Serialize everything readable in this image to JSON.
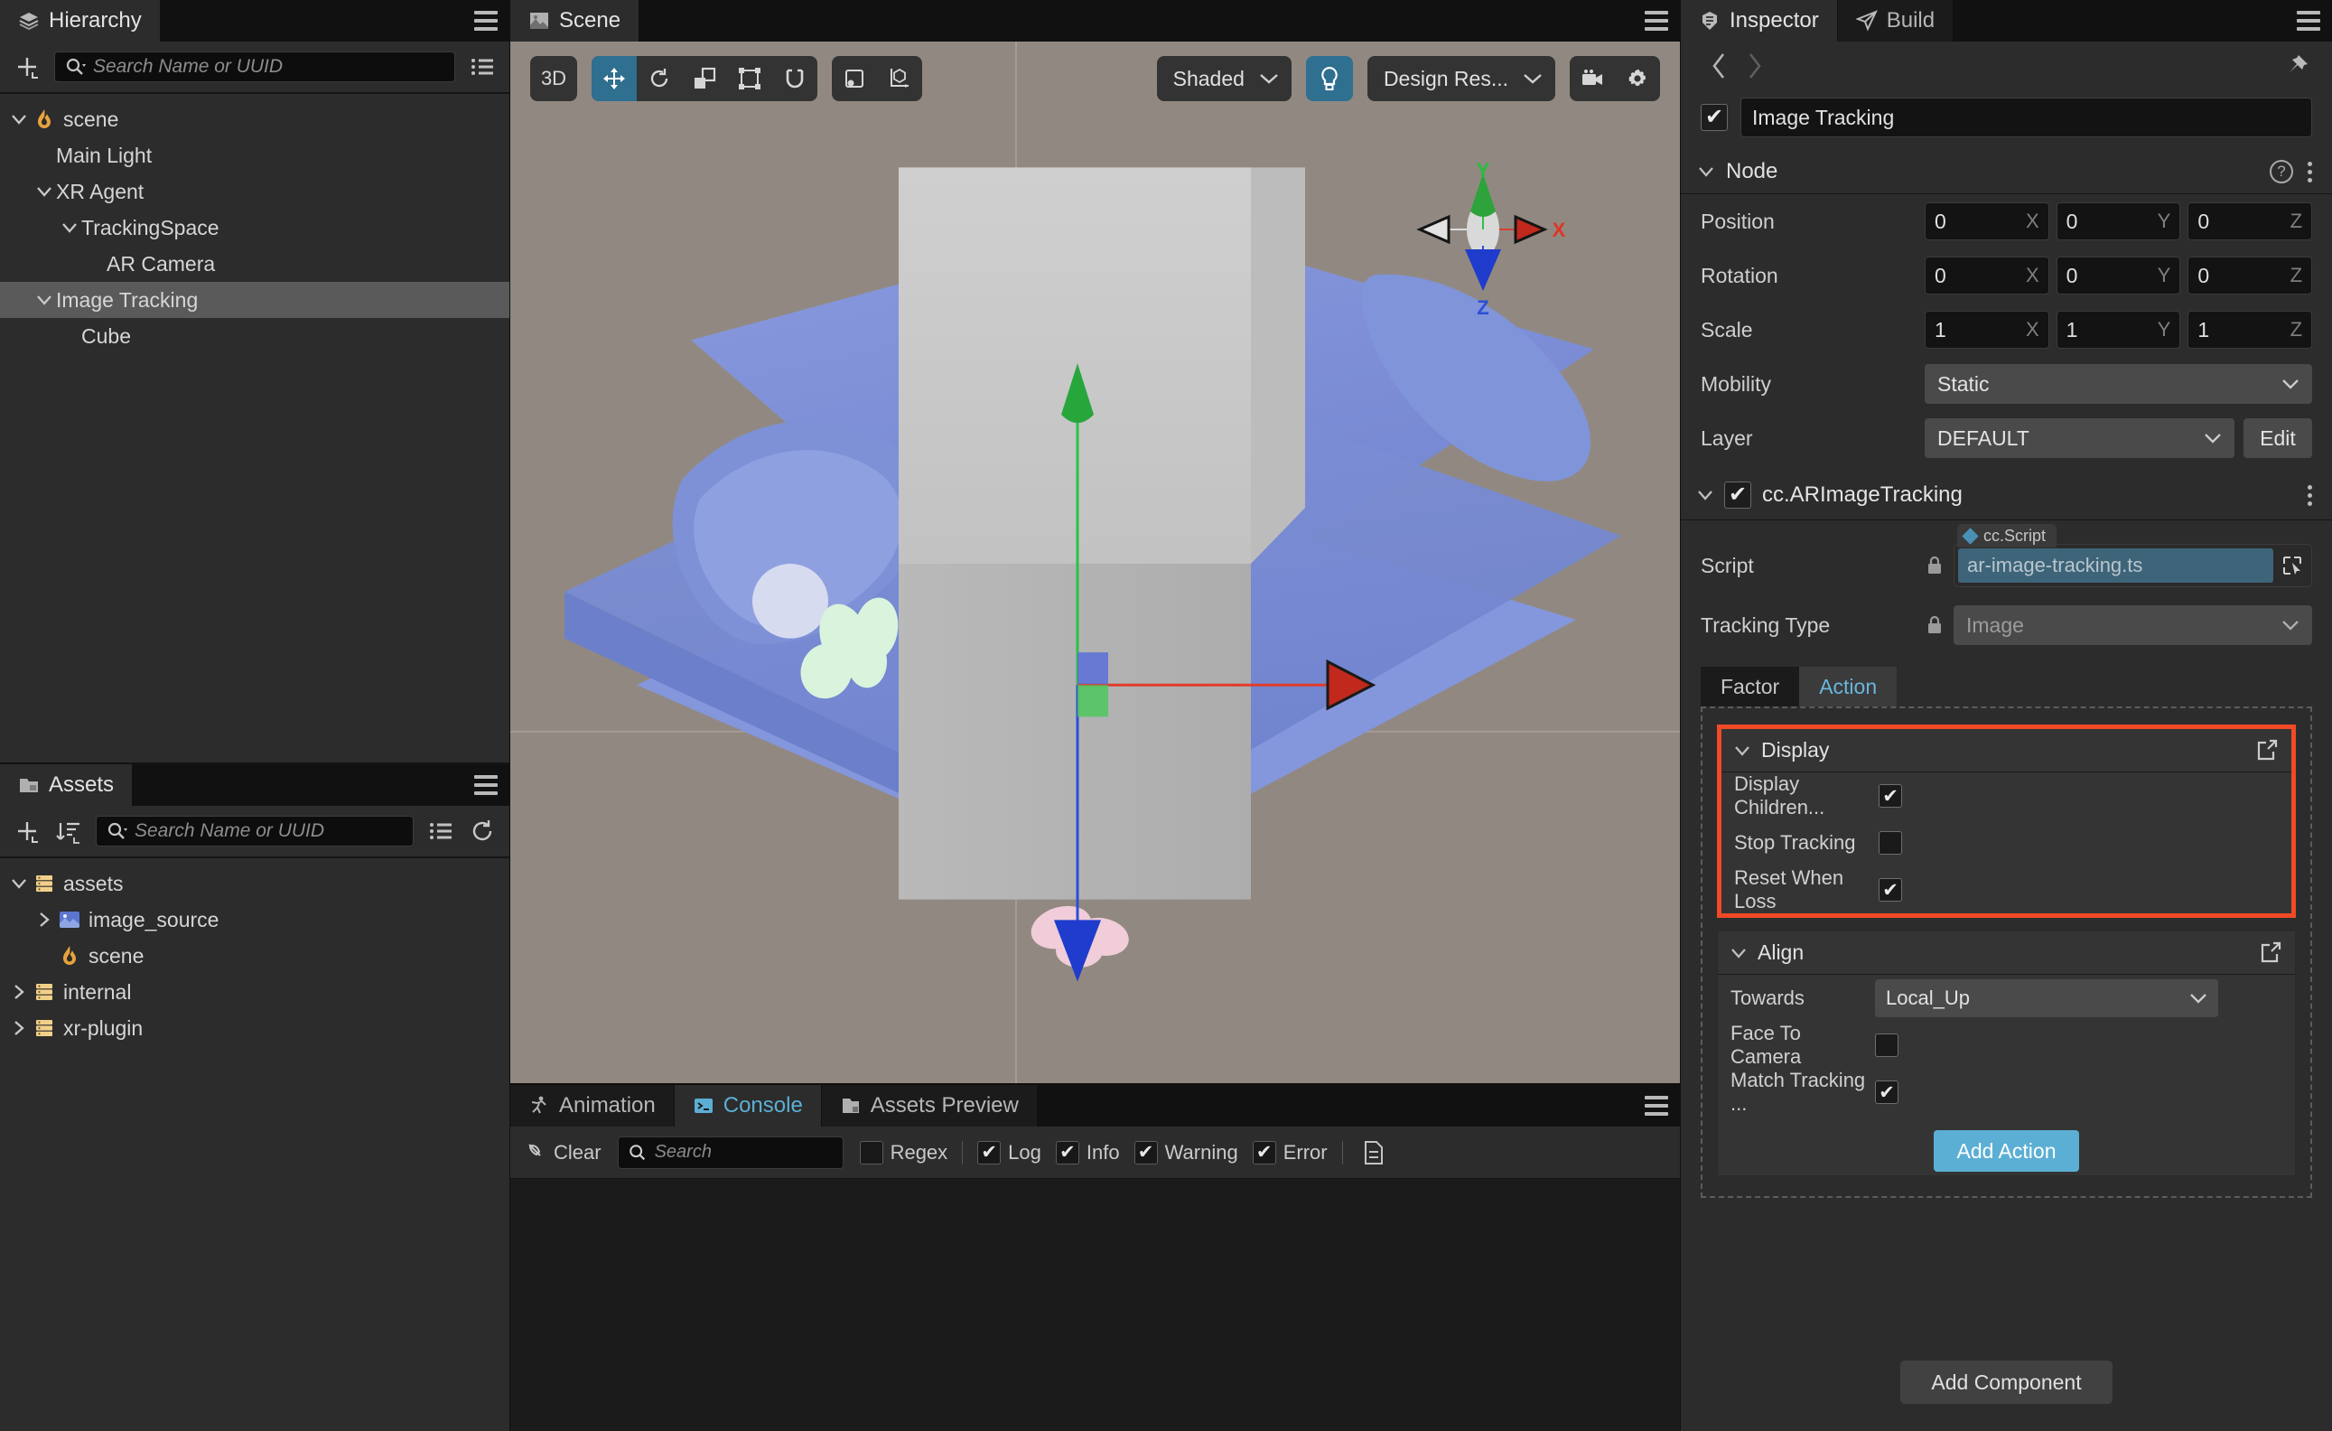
{
  "hierarchy": {
    "tab_label": "Hierarchy",
    "tab_icon": "layers-icon",
    "search_placeholder": "Search Name or UUID",
    "search_value": "",
    "items": [
      {
        "label": "scene",
        "depth": 0,
        "twist": "down",
        "icon": "scene-flame-icon",
        "selected": false
      },
      {
        "label": "Main Light",
        "depth": 1,
        "twist": "none",
        "icon": "none",
        "selected": false
      },
      {
        "label": "XR Agent",
        "depth": 1,
        "twist": "down",
        "icon": "none",
        "selected": false
      },
      {
        "label": "TrackingSpace",
        "depth": 2,
        "twist": "down",
        "icon": "none",
        "selected": false
      },
      {
        "label": "AR Camera",
        "depth": 3,
        "twist": "none",
        "icon": "none",
        "selected": false
      },
      {
        "label": "Image Tracking",
        "depth": 1,
        "twist": "down",
        "icon": "none",
        "selected": true
      },
      {
        "label": "Cube",
        "depth": 2,
        "twist": "none",
        "icon": "none",
        "selected": false
      }
    ]
  },
  "assets": {
    "tab_label": "Assets",
    "tab_icon": "folder-icon",
    "search_placeholder": "Search Name or UUID",
    "search_value": "",
    "items": [
      {
        "label": "assets",
        "depth": 0,
        "twist": "down",
        "icon": "db-folder-icon",
        "selected": false
      },
      {
        "label": "image_source",
        "depth": 1,
        "twist": "right",
        "icon": "image-asset-icon",
        "selected": false
      },
      {
        "label": "scene",
        "depth": 1,
        "twist": "none",
        "icon": "scene-flame-icon",
        "selected": false
      },
      {
        "label": "internal",
        "depth": 0,
        "twist": "right",
        "icon": "db-folder-icon",
        "selected": false
      },
      {
        "label": "xr-plugin",
        "depth": 0,
        "twist": "right",
        "icon": "db-folder-icon",
        "selected": false
      }
    ]
  },
  "scene": {
    "tab_label": "Scene",
    "tab_icon": "image-icon",
    "toolbar": {
      "mode_3d": "3D",
      "tools": [
        {
          "name": "move-tool",
          "active": true
        },
        {
          "name": "rotate-tool",
          "active": false
        },
        {
          "name": "scale-tool",
          "active": false
        },
        {
          "name": "rect-tool",
          "active": false
        },
        {
          "name": "magnet-tool",
          "active": false
        }
      ],
      "pivot_tools": [
        {
          "name": "pivot-center-tool"
        },
        {
          "name": "coordinate-local-tool"
        }
      ],
      "shading_mode": "Shaded",
      "lighting_on": true,
      "resolution_mode": "Design Res...",
      "camera_icon": "camera-icon",
      "settings_icon": "gear-icon"
    },
    "gizmo": {
      "x_label": "X",
      "y_label": "Y",
      "z_label": "Z"
    },
    "viewport_background": "#918981",
    "terrain_color": "#7b8cd4"
  },
  "bottom": {
    "tabs": [
      {
        "label": "Assets Preview",
        "icon": "assets-preview-icon",
        "active": false
      },
      {
        "label": "Console",
        "icon": "console-icon",
        "active": true
      },
      {
        "label": "Animation",
        "icon": "animation-icon",
        "active": false
      }
    ],
    "console": {
      "clear_label": "Clear",
      "clear_icon": "clear-icon",
      "search_placeholder": "Search",
      "search_value": "",
      "filters": [
        {
          "label": "Regex",
          "checked": false
        },
        {
          "label": "Log",
          "checked": true
        },
        {
          "label": "Info",
          "checked": true
        },
        {
          "label": "Warning",
          "checked": true
        },
        {
          "label": "Error",
          "checked": true
        }
      ],
      "doc_icon": "document-icon",
      "messages": []
    }
  },
  "inspector": {
    "tabs": [
      {
        "label": "Inspector",
        "icon": "inspector-icon",
        "active": true
      },
      {
        "label": "Build",
        "icon": "build-icon",
        "active": false
      }
    ],
    "back_icon": "chevron-left-icon",
    "forward_icon": "chevron-right-icon",
    "pin_icon": "pin-icon",
    "node_enabled": true,
    "node_name": "Image Tracking",
    "node_section": {
      "title": "Node",
      "help_icon": "question-icon",
      "menu_icon": "kebab-icon",
      "position": {
        "label": "Position",
        "x": "0",
        "y": "0",
        "z": "0",
        "ax": "X",
        "ay": "Y",
        "az": "Z"
      },
      "rotation": {
        "label": "Rotation",
        "x": "0",
        "y": "0",
        "z": "0",
        "ax": "X",
        "ay": "Y",
        "az": "Z"
      },
      "scale": {
        "label": "Scale",
        "x": "1",
        "y": "1",
        "z": "1",
        "ax": "X",
        "ay": "Y",
        "az": "Z"
      },
      "mobility": {
        "label": "Mobility",
        "value": "Static"
      },
      "layer": {
        "label": "Layer",
        "value": "DEFAULT",
        "edit_label": "Edit"
      }
    },
    "component": {
      "title": "cc.ARImageTracking",
      "enabled": true,
      "menu_icon": "kebab-icon",
      "script": {
        "label": "Script",
        "tag": "cc.Script",
        "value": "ar-image-tracking.ts",
        "locked": true,
        "picker_icon": "node-picker-icon"
      },
      "tracking_type": {
        "label": "Tracking Type",
        "value": "Image",
        "locked": true
      },
      "tabs": [
        {
          "label": "Factor",
          "active": false
        },
        {
          "label": "Action",
          "active": true
        }
      ],
      "display_panel": {
        "title": "Display",
        "highlighted": true,
        "expand_icon": "external-edit-icon",
        "rows": [
          {
            "label": "Display Children...",
            "checked": true
          },
          {
            "label": "Stop Tracking",
            "checked": false
          },
          {
            "label": "Reset When Loss",
            "checked": true
          }
        ]
      },
      "align_panel": {
        "title": "Align",
        "expand_icon": "external-edit-icon",
        "towards": {
          "label": "Towards",
          "value": "Local_Up"
        },
        "rows": [
          {
            "label": "Face To Camera",
            "checked": false
          },
          {
            "label": "Match Tracking ...",
            "checked": true
          }
        ]
      },
      "add_action_label": "Add Action"
    },
    "add_component_label": "Add Component",
    "accent_color": "#5cafd4",
    "highlight_color": "#f04a26"
  }
}
